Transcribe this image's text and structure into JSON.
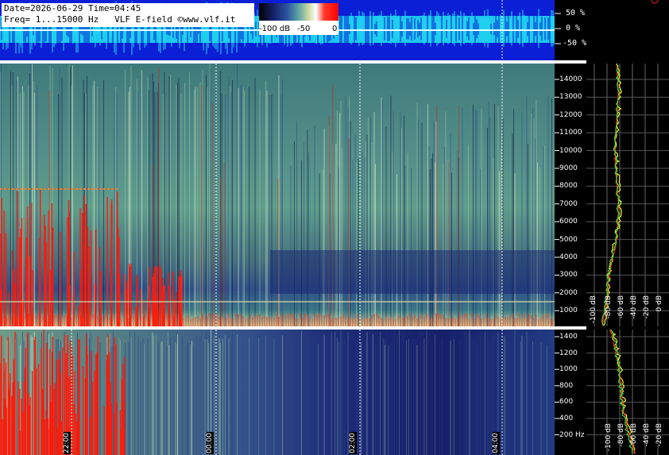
{
  "info": {
    "line1": "Date=2026-06-29 Time=04:45",
    "line2": "Freq= 1...15000 Hz   VLF E-field ©www.vlf.it"
  },
  "colorbar": {
    "min_label": "-100 dB",
    "mid_label": "-50",
    "max_label": "0"
  },
  "amplitude_ticks": [
    "50 %",
    "0 %",
    "-50 %"
  ],
  "main_freq_ticks": [
    "14000",
    "13000",
    "12000",
    "11000",
    "10000",
    "9000",
    "8000",
    "7000",
    "6000",
    "5000",
    "4000",
    "3000",
    "2000",
    "1000"
  ],
  "low_freq_ticks": [
    "1400",
    "1200",
    "1000",
    "800",
    "600",
    "400",
    "200 Hz"
  ],
  "db_ticks_main": [
    "0 dB",
    "-20 dB",
    "-40 dB",
    "-60 dB",
    "-80 dB",
    "-100 dB"
  ],
  "db_ticks_low": [
    "-20 dB",
    "-40 dB",
    "-60 dB",
    "-80 dB",
    "-100 dB"
  ],
  "time_marks": [
    "22:00",
    "00:00",
    "02:00",
    "04:00"
  ],
  "colors": {
    "amplitude_bg": "#0b1fd6",
    "amplitude_band": "#1fd9f0",
    "spectrum_red": "#ff1a0a",
    "spectrum_white": "#ffffff",
    "curve_red": "#ff2020",
    "curve_yellow": "#f2f230",
    "curve_green": "#40e040"
  }
}
